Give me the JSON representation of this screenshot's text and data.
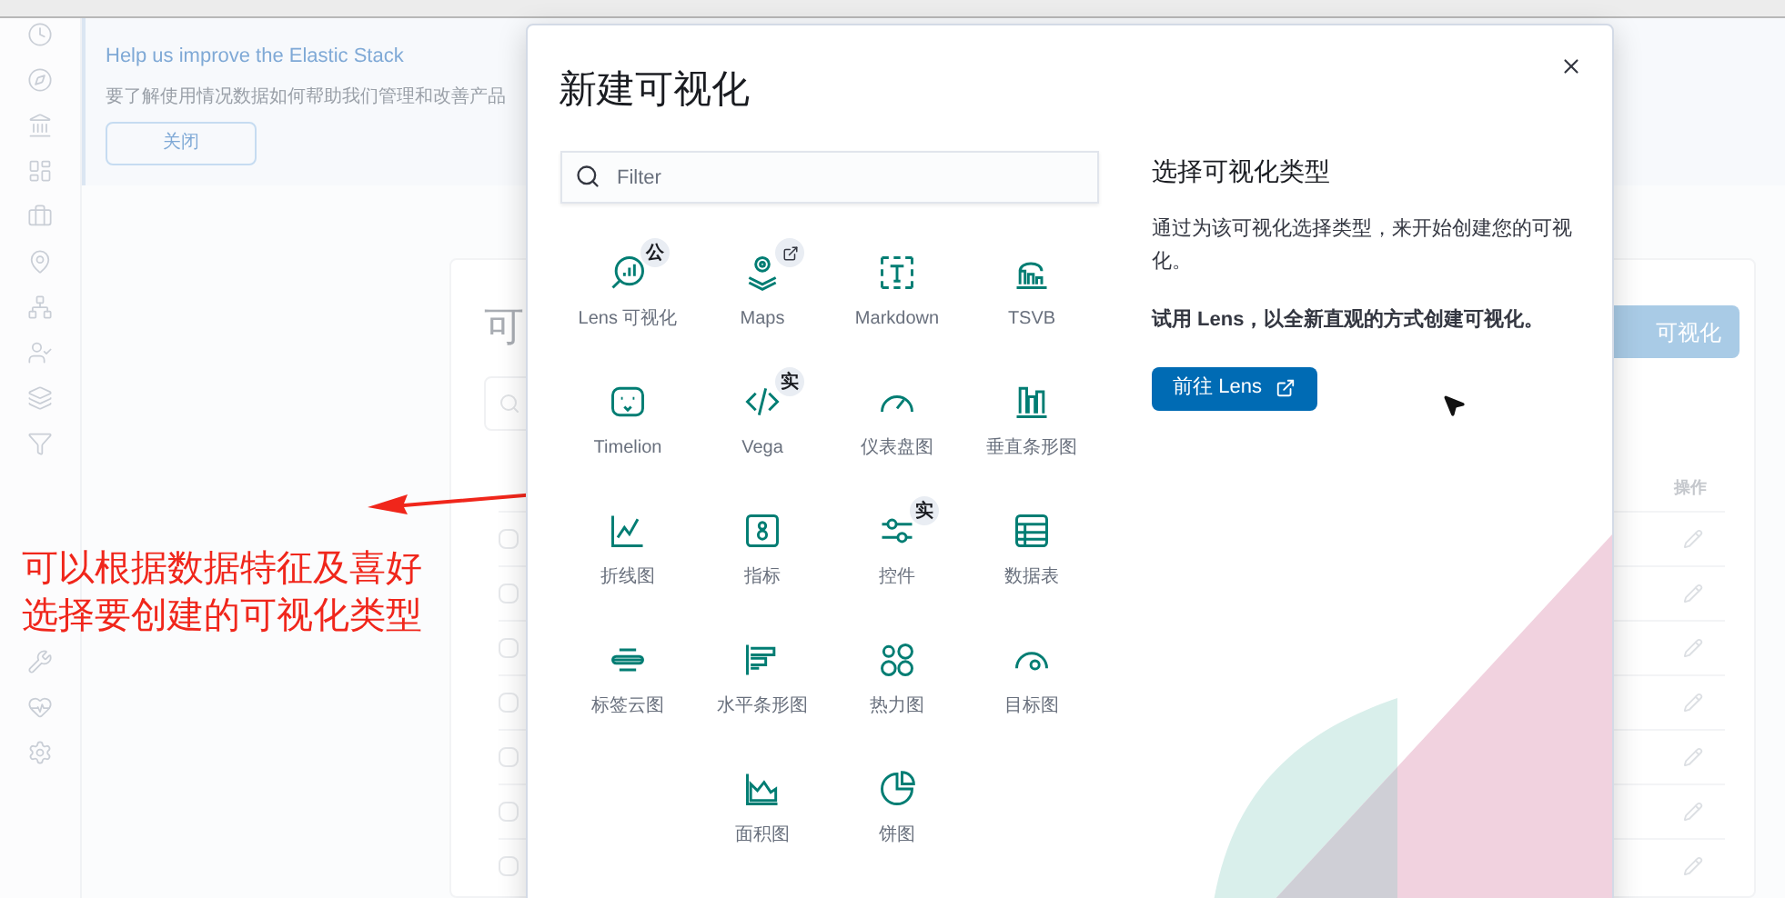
{
  "banner": {
    "title": "Help us improve the Elastic Stack",
    "text": "要了解使用情况数据如何帮助我们管理和改善产品",
    "button": "关闭"
  },
  "background": {
    "page_title": "可",
    "create_button": "可视化",
    "actions_header": "操作",
    "rows": [
      {
        "checked": false
      },
      {
        "checked": false
      },
      {
        "checked": false
      },
      {
        "checked": false
      },
      {
        "checked": false
      },
      {
        "checked": false
      },
      {
        "checked": false
      }
    ]
  },
  "annotation": {
    "lines": [
      "可以根据数据特征及喜好",
      "选择要创建的可视化类型"
    ]
  },
  "modal": {
    "title": "新建可视化",
    "filter": {
      "placeholder": "Filter"
    },
    "types": [
      {
        "label": "Lens 可视化",
        "badge": {
          "kind": "text",
          "text": "公"
        }
      },
      {
        "label": "Maps",
        "badge": {
          "kind": "link"
        }
      },
      {
        "label": "Markdown"
      },
      {
        "label": "TSVB"
      },
      {
        "label": "Timelion"
      },
      {
        "label": "Vega",
        "badge": {
          "kind": "text",
          "text": "实"
        }
      },
      {
        "label": "仪表盘图"
      },
      {
        "label": "垂直条形图"
      },
      {
        "label": "折线图"
      },
      {
        "label": "指标"
      },
      {
        "label": "控件",
        "badge": {
          "kind": "text",
          "text": "实"
        }
      },
      {
        "label": "数据表"
      },
      {
        "label": "标签云图"
      },
      {
        "label": "水平条形图"
      },
      {
        "label": "热力图"
      },
      {
        "label": "目标图"
      },
      {
        "label": "面积图"
      },
      {
        "label": "饼图"
      }
    ],
    "info": {
      "title": "选择可视化类型",
      "text": "通过为该可视化选择类型，来开始创建您的可视化。",
      "promo": "试用 Lens，以全新直观的方式创建可视化。",
      "button": "前往 Lens"
    }
  }
}
